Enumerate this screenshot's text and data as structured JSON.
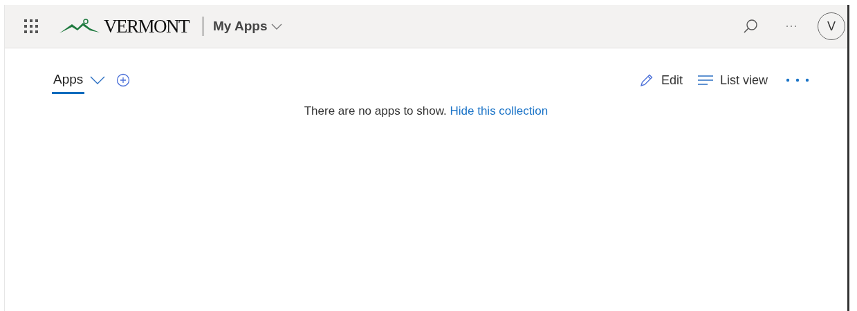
{
  "header": {
    "logo_text": "VERMONT",
    "app_title": "My Apps",
    "avatar": "V"
  },
  "tabs": [
    {
      "label": "Apps",
      "selected": true
    }
  ],
  "toolbar": [
    {
      "kind": "edit",
      "label": "Edit"
    },
    {
      "kind": "list",
      "label": "List view"
    },
    {
      "kind": "more"
    }
  ],
  "message": {
    "text": "There are no apps to show.",
    "link": "Hide this collection"
  }
}
